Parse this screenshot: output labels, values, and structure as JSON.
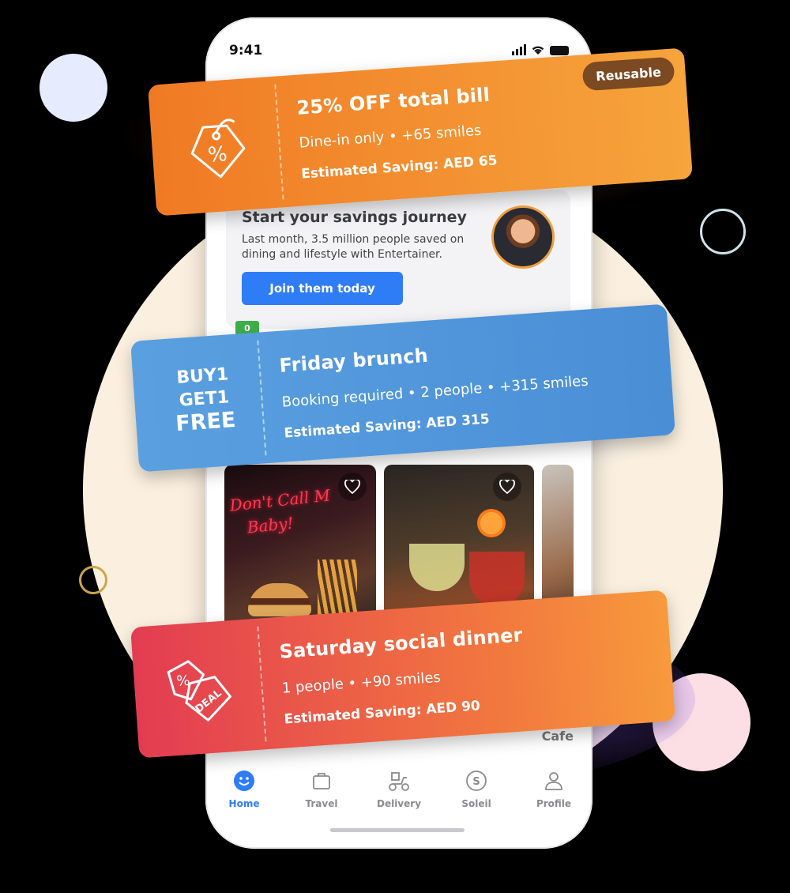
{
  "status_bar": {
    "time": "9:41"
  },
  "card": {
    "title": "Start your savings journey",
    "text": "Last month, 3.5 million people saved on dining and lifestyle with Entertainer.",
    "button_label": "Join them today"
  },
  "progress": {
    "start_label": "0",
    "value_fraction": 0.02
  },
  "partial_label": "Cafe",
  "tabs": [
    {
      "label": "Home",
      "icon": "smiley-icon",
      "active": true
    },
    {
      "label": "Travel",
      "icon": "suitcase-icon",
      "active": false
    },
    {
      "label": "Delivery",
      "icon": "scooter-icon",
      "active": false
    },
    {
      "label": "Soleil",
      "icon": "soleil-icon",
      "active": false
    },
    {
      "label": "Profile",
      "icon": "person-icon",
      "active": false
    }
  ],
  "tickets": [
    {
      "title": "25% OFF total bill",
      "details": "Dine-in only • +65 smiles",
      "saving": "Estimated Saving: AED  65",
      "badge": "Reusable",
      "icon": "percent-tag-icon",
      "color_start": "#f07a24",
      "color_end": "#f6a43c"
    },
    {
      "title": "Friday brunch",
      "details": "Booking required • 2 people • +315 smiles",
      "saving": "Estimated Saving: AED 315",
      "offer_lines": [
        "BUY1",
        "GET1",
        "FREE"
      ],
      "color_start": "#5aa0e0",
      "color_end": "#4a8ed6"
    },
    {
      "title": "Saturday social dinner",
      "details": "1 people • +90 smiles",
      "saving": "Estimated Saving: AED 90",
      "icon": "deal-tag-icon",
      "color_start": "#e33c52",
      "color_end": "#f79a3c"
    }
  ],
  "accent_color": "#2f7df6"
}
